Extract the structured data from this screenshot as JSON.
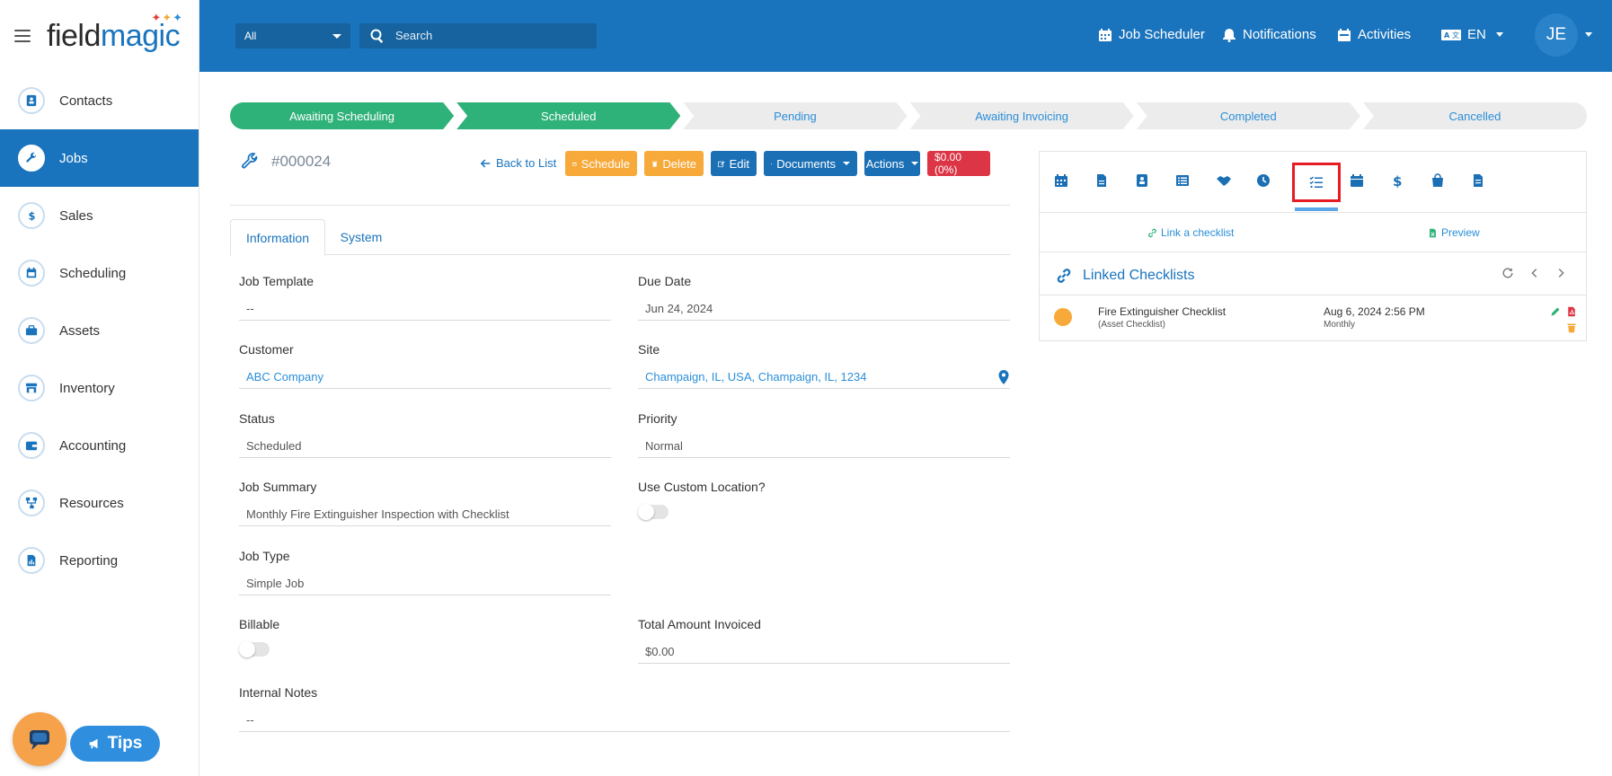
{
  "brand": {
    "logo_part1": "field",
    "logo_part2": "magic",
    "sparkle": "✦✦✦"
  },
  "header": {
    "scope_select": "All",
    "search_placeholder": "Search",
    "job_scheduler": "Job Scheduler",
    "notifications": "Notifications",
    "activities": "Activities",
    "language": "EN",
    "avatar_initials": "JE"
  },
  "sidebar": {
    "items": [
      {
        "label": "Contacts",
        "icon": "contact-card-icon"
      },
      {
        "label": "Jobs",
        "icon": "wrench-icon",
        "active": true
      },
      {
        "label": "Sales",
        "icon": "dollar-icon"
      },
      {
        "label": "Scheduling",
        "icon": "calendar-icon"
      },
      {
        "label": "Assets",
        "icon": "briefcase-icon"
      },
      {
        "label": "Inventory",
        "icon": "store-icon"
      },
      {
        "label": "Accounting",
        "icon": "wallet-icon"
      },
      {
        "label": "Resources",
        "icon": "network-icon"
      },
      {
        "label": "Reporting",
        "icon": "report-icon"
      }
    ]
  },
  "tips": {
    "label": "Tips"
  },
  "pipeline": {
    "stages": [
      {
        "label": "Awaiting Scheduling",
        "done": true
      },
      {
        "label": "Scheduled",
        "done": true
      },
      {
        "label": "Pending",
        "done": false
      },
      {
        "label": "Awaiting Invoicing",
        "done": false
      },
      {
        "label": "Completed",
        "done": false
      },
      {
        "label": "Cancelled",
        "done": false
      }
    ]
  },
  "job": {
    "number": "#000024",
    "back_to_list": "Back to List",
    "schedule_btn": "Schedule",
    "delete_btn": "Delete",
    "edit_btn": "Edit",
    "documents_btn": "Documents",
    "actions_btn": "Actions",
    "amount_badge": "$0.00 (0%)"
  },
  "tabs": {
    "information": "Information",
    "system": "System"
  },
  "form": {
    "job_template": {
      "label": "Job Template",
      "value": "--"
    },
    "due_date": {
      "label": "Due Date",
      "value": "Jun 24, 2024"
    },
    "customer": {
      "label": "Customer",
      "value": "ABC Company"
    },
    "site": {
      "label": "Site",
      "value": "Champaign, IL, USA, Champaign, IL, 1234"
    },
    "status": {
      "label": "Status",
      "value": "Scheduled"
    },
    "priority": {
      "label": "Priority",
      "value": "Normal"
    },
    "job_summary": {
      "label": "Job Summary",
      "value": "Monthly Fire Extinguisher Inspection with Checklist"
    },
    "use_custom_location": {
      "label": "Use Custom Location?",
      "checked": false
    },
    "job_type": {
      "label": "Job Type",
      "value": "Simple Job"
    },
    "billable": {
      "label": "Billable",
      "checked": false
    },
    "total_invoiced": {
      "label": "Total Amount Invoiced",
      "value": "$0.00"
    },
    "internal_notes": {
      "label": "Internal Notes",
      "value": "--"
    }
  },
  "right_panel": {
    "selected_tab_icon": "checklist-icon",
    "link_checklist": "Link a checklist",
    "preview": "Preview",
    "list_title": "Linked Checklists",
    "checklists": [
      {
        "name": "Fire Extinguisher Checklist",
        "type": "(Asset Checklist)",
        "date": "Aug 6, 2024 2:56 PM",
        "frequency": "Monthly",
        "status_color": "#f7a93a"
      }
    ]
  }
}
